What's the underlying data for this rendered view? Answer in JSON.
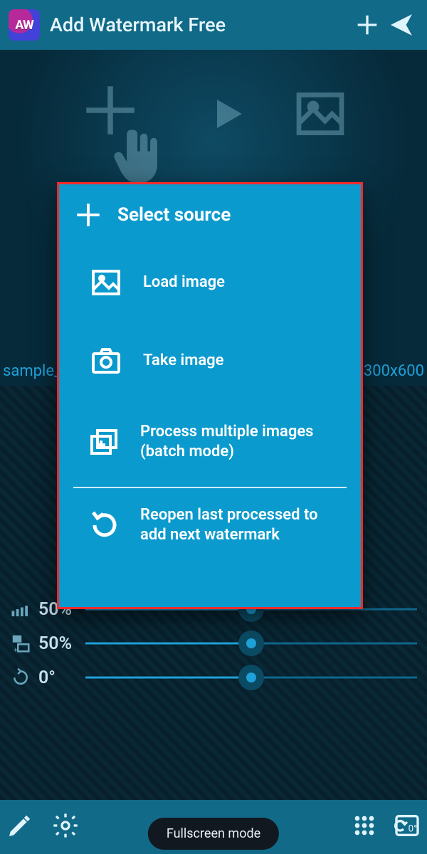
{
  "appbar": {
    "title": "Add Watermark Free"
  },
  "filebar": {
    "name_left": "sample_",
    "dims_right": "300x600"
  },
  "sliders": {
    "opacity": {
      "value": "50%",
      "pos": 50
    },
    "size": {
      "value": "50%",
      "pos": 50
    },
    "angle": {
      "value": "0°",
      "pos": 50
    }
  },
  "modal": {
    "title": "Select source",
    "items": {
      "load": "Load image",
      "take": "Take image",
      "batch": "Process multiple images (batch mode)",
      "reopen": "Reopen last processed to add next watermark"
    }
  },
  "toast": {
    "text": "Fullscreen mode"
  }
}
